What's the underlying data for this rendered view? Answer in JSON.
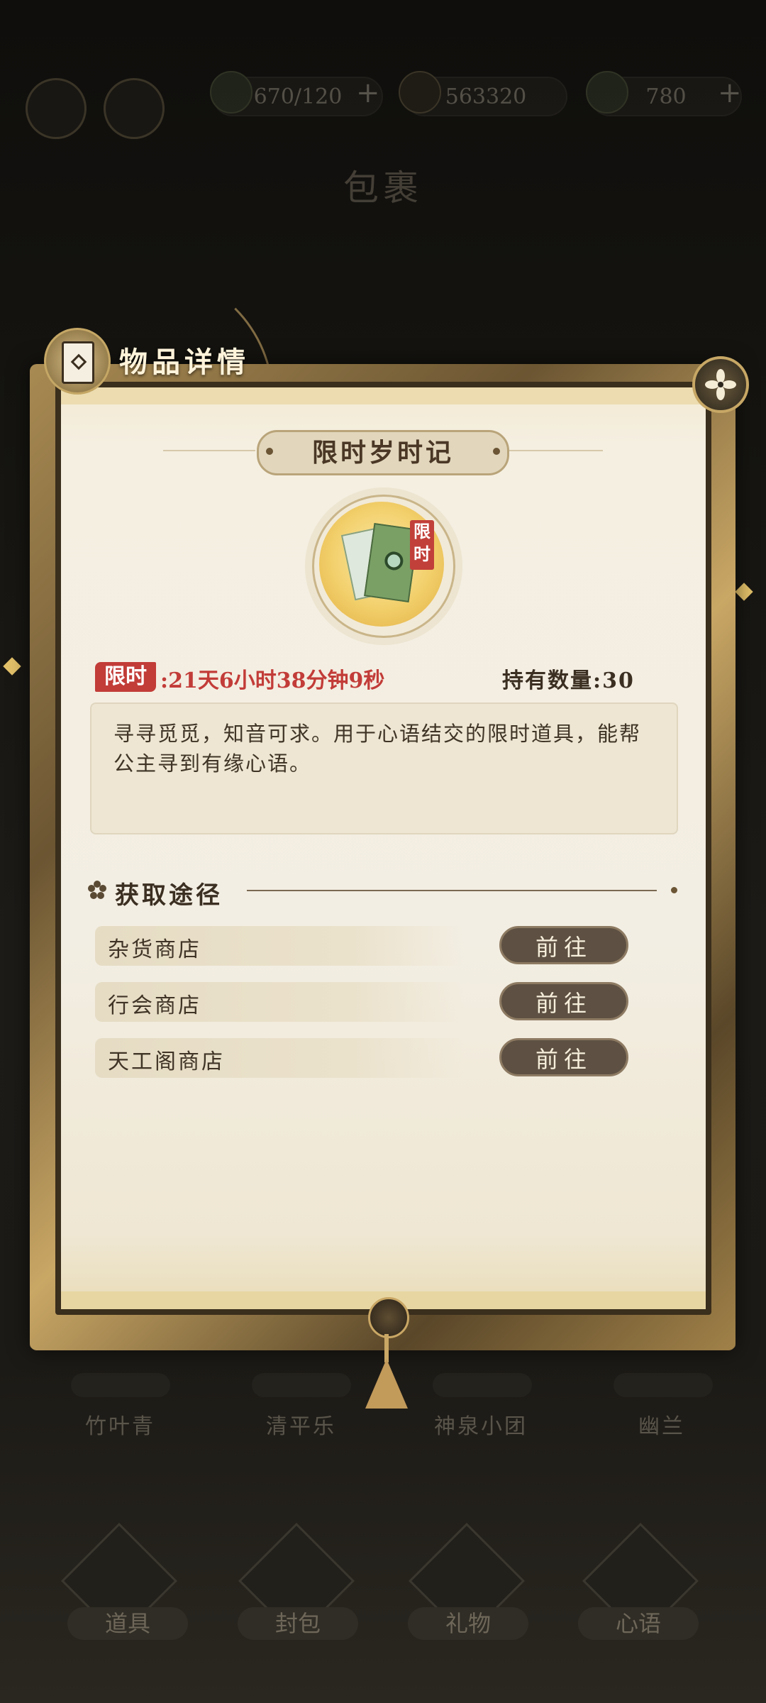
{
  "background": {
    "resources": [
      {
        "icon": "leaf-icon",
        "value": "670/120",
        "plus": "+"
      },
      {
        "icon": "coin-icon",
        "value": "563320",
        "plus": ""
      },
      {
        "icon": "gem-icon",
        "value": "780",
        "plus": "+"
      }
    ],
    "page_title": "包裹",
    "items": [
      {
        "name": "竹叶青"
      },
      {
        "name": "清平乐"
      },
      {
        "name": "神泉小团"
      },
      {
        "name": "幽兰"
      }
    ],
    "tabs": [
      "道具",
      "封包",
      "礼物",
      "心语"
    ]
  },
  "panel": {
    "title": "物品详情",
    "item_name": "限时岁时记",
    "item_tag": "限时",
    "limit_badge": "限时",
    "timer": ":21天6小时38分钟9秒",
    "hold_count": "持有数量:30",
    "description": "寻寻觅觅，知音可求。用于心语结交的限时道具，能帮公主寻到有缘心语。",
    "sources_title": "获取途径",
    "sources": [
      {
        "name": "杂货商店",
        "button": "前往"
      },
      {
        "name": "行会商店",
        "button": "前往"
      },
      {
        "name": "天工阁商店",
        "button": "前往"
      }
    ]
  },
  "colors": {
    "accent_red": "#c23c38",
    "button_brown": "#5e5143",
    "gold_frame": "#c9a765",
    "paper": "#f3eee3"
  }
}
